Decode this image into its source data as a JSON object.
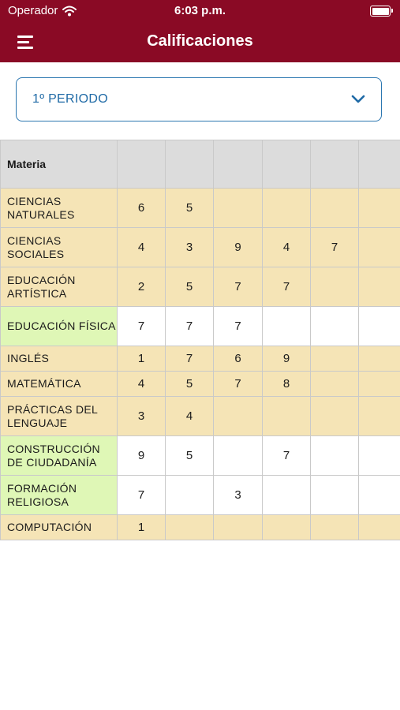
{
  "status": {
    "carrier": "Operador",
    "time": "6:03 p.m."
  },
  "header": {
    "title": "Calificaciones"
  },
  "period": {
    "selected": "1º PERIODO"
  },
  "table": {
    "header": "Materia",
    "rows": [
      {
        "subject": "CIENCIAS NATURALES",
        "grades": [
          "6",
          "5",
          "",
          "",
          "",
          ""
        ],
        "style": "beige",
        "lines": 2
      },
      {
        "subject": "CIENCIAS SOCIALES",
        "grades": [
          "4",
          "3",
          "9",
          "4",
          "7",
          ""
        ],
        "style": "beige",
        "lines": 2
      },
      {
        "subject": "EDUCACIÓN ARTÍSTICA",
        "grades": [
          "2",
          "5",
          "7",
          "7",
          "",
          ""
        ],
        "style": "beige",
        "lines": 2
      },
      {
        "subject": "EDUCACIÓN FÍSICA",
        "grades": [
          "7",
          "7",
          "7",
          "",
          "",
          ""
        ],
        "style": "green",
        "lines": 2
      },
      {
        "subject": "INGLÉS",
        "grades": [
          "1",
          "7",
          "6",
          "9",
          "",
          ""
        ],
        "style": "beige",
        "lines": 1
      },
      {
        "subject": "MATEMÁTICA",
        "grades": [
          "4",
          "5",
          "7",
          "8",
          "",
          ""
        ],
        "style": "beige",
        "lines": 1
      },
      {
        "subject": "PRÁCTICAS DEL LENGUAJE",
        "grades": [
          "3",
          "4",
          "",
          "",
          "",
          ""
        ],
        "style": "beige",
        "lines": 2
      },
      {
        "subject": "CONSTRUCCIÓN DE CIUDADANÍA",
        "grades": [
          "9",
          "5",
          "",
          "7",
          "",
          ""
        ],
        "style": "green",
        "lines": 2
      },
      {
        "subject": "FORMACIÓN RELIGIOSA",
        "grades": [
          "7",
          "",
          "3",
          "",
          "",
          ""
        ],
        "style": "green",
        "lines": 2
      },
      {
        "subject": "COMPUTACIÓN",
        "grades": [
          "1",
          "",
          "",
          "",
          "",
          ""
        ],
        "style": "beige",
        "lines": 1
      }
    ]
  }
}
